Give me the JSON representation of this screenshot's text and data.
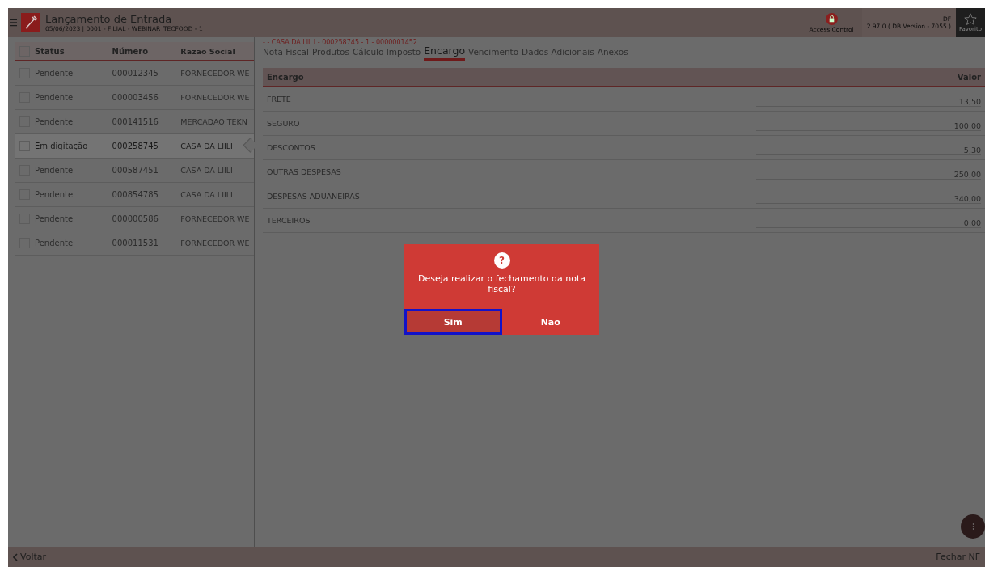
{
  "header": {
    "title": "Lançamento de Entrada",
    "subtitle": "05/06/2023 | 0001 - FILIAL - WEBINAR_TECFOOD - 1",
    "access_control": "Access Control",
    "user": "DF",
    "version": "2.97.0 ( DB Version - 7055 )",
    "favorites": "Favorito"
  },
  "list": {
    "columns": [
      "Status",
      "Número",
      "Razão Social"
    ],
    "all_checked": false,
    "rows": [
      {
        "status": "Pendente",
        "number": "000012345",
        "name": "FORNECEDOR WE",
        "checked": false,
        "selected": false
      },
      {
        "status": "Pendente",
        "number": "000003456",
        "name": "FORNECEDOR WE",
        "checked": false,
        "selected": false
      },
      {
        "status": "Pendente",
        "number": "000141516",
        "name": "MERCADAO TEKN",
        "checked": false,
        "selected": false
      },
      {
        "status": "Em digitação",
        "number": "000258745",
        "name": "CASA DA LIILI",
        "checked": false,
        "selected": true
      },
      {
        "status": "Pendente",
        "number": "000587451",
        "name": "CASA DA LIILI",
        "checked": false,
        "selected": false
      },
      {
        "status": "Pendente",
        "number": "000854785",
        "name": "CASA DA LIILI",
        "checked": false,
        "selected": false
      },
      {
        "status": "Pendente",
        "number": "000000586",
        "name": "FORNECEDOR WE",
        "checked": false,
        "selected": false
      },
      {
        "status": "Pendente",
        "number": "000011531",
        "name": "FORNECEDOR WE",
        "checked": false,
        "selected": false
      }
    ]
  },
  "detail": {
    "breadcrumb": "- - CASA DA LIILI - 000258745 - 1 - 0000001452",
    "tabs": [
      {
        "label": "Nota Fiscal",
        "selected": false
      },
      {
        "label": "Produtos",
        "selected": false
      },
      {
        "label": "Cálculo Imposto",
        "selected": false
      },
      {
        "label": "Encargo",
        "selected": true
      },
      {
        "label": "Vencimento",
        "selected": false
      },
      {
        "label": "Dados Adicionais",
        "selected": false
      },
      {
        "label": "Anexos",
        "selected": false
      }
    ],
    "table": {
      "columns": [
        "Encargo",
        "Valor"
      ],
      "rows": [
        {
          "name": "FRETE",
          "value": "13,50"
        },
        {
          "name": "SEGURO",
          "value": "100,00"
        },
        {
          "name": "DESCONTOS",
          "value": "5,30"
        },
        {
          "name": "OUTRAS DESPESAS",
          "value": "250,00"
        },
        {
          "name": "DESPESAS ADUANEIRAS",
          "value": "340,00"
        },
        {
          "name": "TERCEIROS",
          "value": "0,00"
        }
      ]
    }
  },
  "dialog": {
    "icon": "?",
    "message": "Deseja realizar o fechamento da nota fiscal?",
    "buttons": [
      {
        "label": "Sim",
        "selected": true
      },
      {
        "label": "Não",
        "selected": false
      }
    ]
  },
  "footer": {
    "back": "Voltar",
    "close": "Fechar NF"
  }
}
